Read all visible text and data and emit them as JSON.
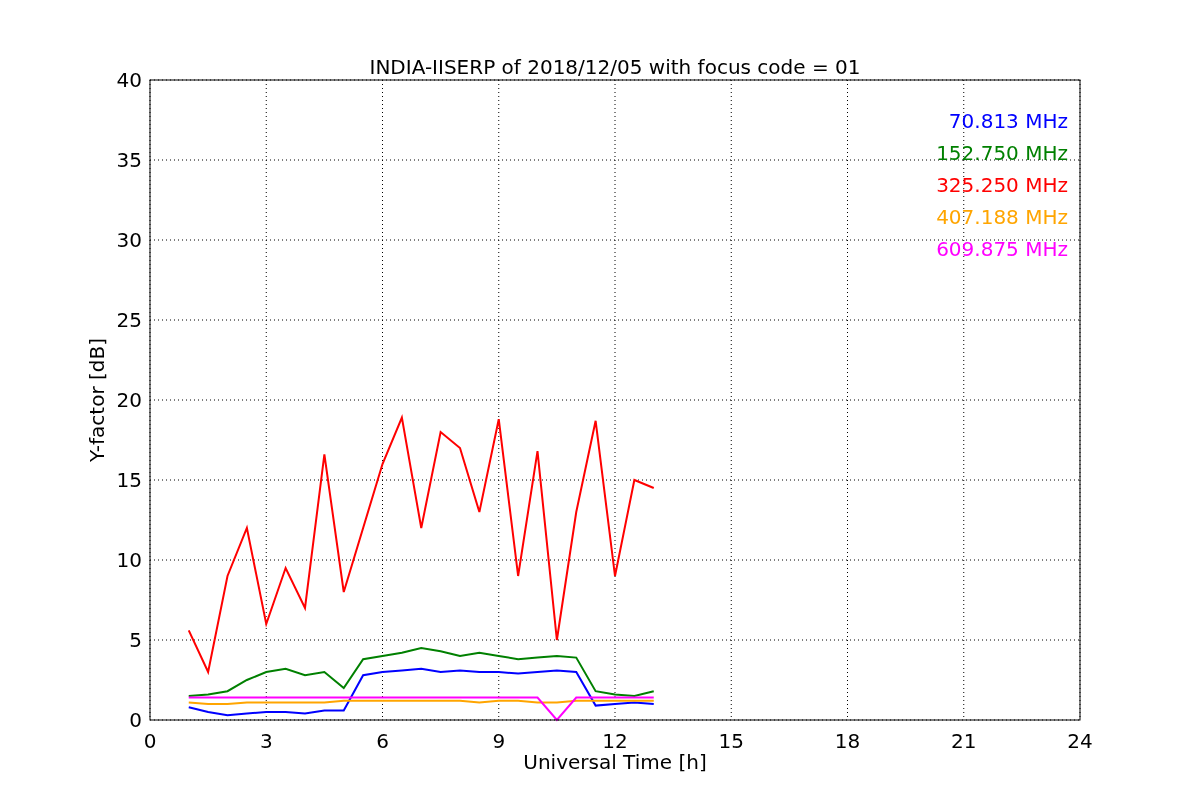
{
  "figure": {
    "chart_data": {
      "type": "line",
      "grid": true,
      "title": "INDIA-IISERP of 2018/12/05 with focus code = 01",
      "xlabel": "Universal Time [h]",
      "ylabel": "Y-factor [dB]",
      "xlim": [
        0,
        24
      ],
      "ylim": [
        0,
        40
      ],
      "xticks": [
        0,
        3,
        6,
        9,
        12,
        15,
        18,
        21,
        24
      ],
      "yticks": [
        0,
        5,
        10,
        15,
        20,
        25,
        30,
        35,
        40
      ],
      "x": [
        1,
        1.5,
        2,
        2.5,
        3,
        3.5,
        4,
        4.5,
        5,
        5.5,
        6,
        6.5,
        7,
        7.5,
        8,
        8.5,
        9,
        9.5,
        10,
        10.5,
        11,
        11.5,
        12,
        12.5,
        13
      ],
      "series": [
        {
          "name": "70.813 MHz",
          "color": "#0000ff",
          "values": [
            0.8,
            0.5,
            0.3,
            0.4,
            0.5,
            0.5,
            0.4,
            0.6,
            0.6,
            2.8,
            3.0,
            3.1,
            3.2,
            3.0,
            3.1,
            3.0,
            3.0,
            2.9,
            3.0,
            3.1,
            3.0,
            0.9,
            1.0,
            1.1,
            1.0
          ]
        },
        {
          "name": "152.750 MHz",
          "color": "#008000",
          "values": [
            1.5,
            1.6,
            1.8,
            2.5,
            3.0,
            3.2,
            2.8,
            3.0,
            2.0,
            3.8,
            4.0,
            4.2,
            4.5,
            4.3,
            4.0,
            4.2,
            4.0,
            3.8,
            3.9,
            4.0,
            3.9,
            1.8,
            1.6,
            1.5,
            1.8
          ]
        },
        {
          "name": "325.250 MHz",
          "color": "#ff0000",
          "values": [
            5.6,
            3.0,
            9.0,
            12.0,
            6.0,
            9.5,
            7.0,
            16.6,
            8.0,
            12.0,
            16.0,
            18.9,
            12.0,
            18.0,
            17.0,
            13.0,
            18.8,
            9.0,
            16.8,
            5.0,
            13.0,
            18.7,
            9.0,
            15.0,
            14.5
          ]
        },
        {
          "name": "407.188 MHz",
          "color": "#ffa500",
          "values": [
            1.1,
            1.0,
            1.0,
            1.1,
            1.1,
            1.1,
            1.1,
            1.1,
            1.2,
            1.2,
            1.2,
            1.2,
            1.2,
            1.2,
            1.2,
            1.1,
            1.2,
            1.2,
            1.1,
            1.1,
            1.2,
            1.2,
            1.2,
            1.2,
            1.2
          ]
        },
        {
          "name": "609.875 MHz",
          "color": "#ff00ff",
          "values": [
            1.4,
            1.4,
            1.4,
            1.4,
            1.4,
            1.4,
            1.4,
            1.4,
            1.4,
            1.4,
            1.4,
            1.4,
            1.4,
            1.4,
            1.4,
            1.4,
            1.4,
            1.4,
            1.4,
            0,
            1.4,
            1.4,
            1.4,
            1.4,
            1.4
          ]
        }
      ]
    }
  }
}
